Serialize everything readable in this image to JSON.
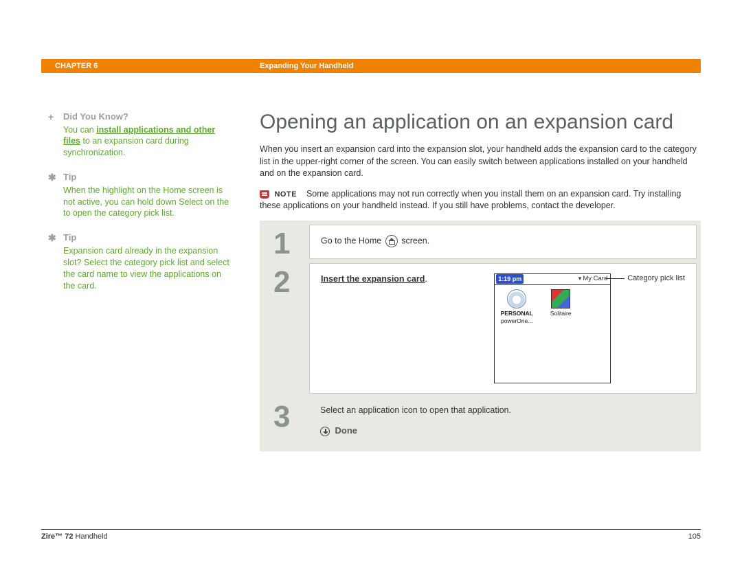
{
  "header": {
    "chapter": "CHAPTER 6",
    "title": "Expanding Your Handheld"
  },
  "sidebar": {
    "didyou": {
      "heading": "Did You Know?",
      "pre": "You can ",
      "link": "install applications and other files",
      "post": " to an expansion card during synchronization."
    },
    "tip1": {
      "heading": "Tip",
      "text": "When the highlight on the Home screen is not active, you can hold down Select on the to open the category pick list."
    },
    "tip2": {
      "heading": "Tip",
      "text": "Expansion card already in the expansion slot? Select the category pick list and select the card name to view the applications on the card."
    }
  },
  "main": {
    "title": "Opening an application on an expansion card",
    "intro": "When you insert an expansion card into the expansion slot, your handheld adds the expansion card to the category list in the upper-right corner of the screen. You can easily switch between applications installed on your handheld and on the expansion card.",
    "note_label": "NOTE",
    "note_text": "Some applications may not run correctly when you install them on an expansion card. Try installing these applications on your handheld instead. If you still have problems, contact the developer."
  },
  "steps": {
    "s1": {
      "num": "1",
      "pre": "Go to the Home ",
      "post": " screen."
    },
    "s2": {
      "num": "2",
      "link": "Insert the expansion card",
      "post": ".",
      "device": {
        "time": "1:19 pm",
        "category": "My Card",
        "apps": [
          {
            "label_line1": "PERSONAL",
            "label_line2": "powerOne..."
          },
          {
            "label_line1": "",
            "label_line2": "Solitaire"
          }
        ]
      },
      "callout": "Category pick list"
    },
    "s3": {
      "num": "3",
      "text": "Select an application icon to open that application.",
      "done": "Done"
    }
  },
  "footer": {
    "product_bold": "Zire™ 72",
    "product_rest": " Handheld",
    "page": "105"
  }
}
